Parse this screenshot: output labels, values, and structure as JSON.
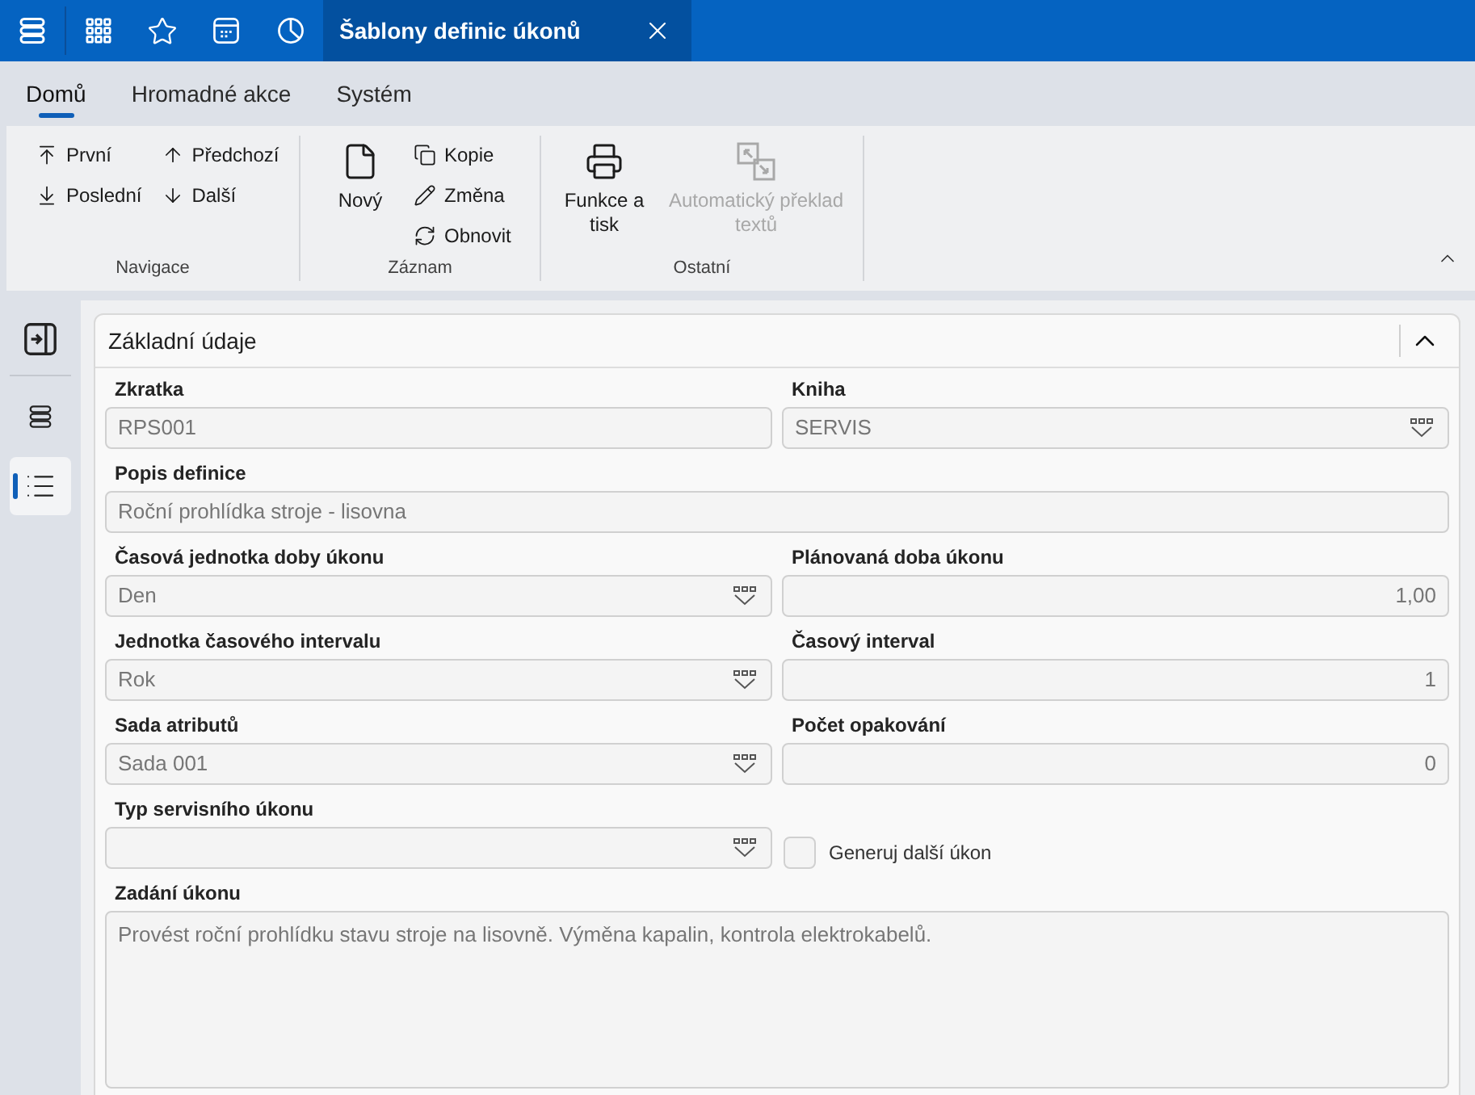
{
  "top_bar": {
    "tab": {
      "title": "Šablony definic úkonů"
    }
  },
  "ribbon_tabs": [
    {
      "label": "Domů",
      "selected": true
    },
    {
      "label": "Hromadné akce",
      "selected": false
    },
    {
      "label": "Systém",
      "selected": false
    }
  ],
  "ribbon": {
    "groups": [
      {
        "label": "Navigace",
        "columns": [
          {
            "items": [
              {
                "label": "První",
                "kind": "small",
                "disabled": false
              },
              {
                "label": "Poslední",
                "kind": "small",
                "disabled": false
              }
            ]
          },
          {
            "items": [
              {
                "label": "Předchozí",
                "kind": "small",
                "disabled": false
              },
              {
                "label": "Další",
                "kind": "small",
                "disabled": false
              }
            ]
          }
        ]
      },
      {
        "label": "Záznam",
        "columns": [
          {
            "items": [
              {
                "label": "Nový",
                "kind": "large",
                "disabled": false
              }
            ]
          },
          {
            "items": [
              {
                "label": "Kopie",
                "kind": "small",
                "disabled": false
              },
              {
                "label": "Změna",
                "kind": "small",
                "disabled": false
              },
              {
                "label": "Obnovit",
                "kind": "small",
                "disabled": false
              }
            ]
          }
        ]
      },
      {
        "label": "Ostatní",
        "columns": [
          {
            "items": [
              {
                "label": "Funkce a tisk",
                "kind": "large",
                "disabled": false
              }
            ]
          },
          {
            "items": [
              {
                "label": "Automatický překlad textů",
                "kind": "large",
                "disabled": true
              }
            ]
          }
        ]
      }
    ]
  },
  "sidebar": {
    "items": [
      {
        "selected": false
      },
      {
        "selected": true
      }
    ]
  },
  "section": {
    "title": "Základní údaje",
    "expanded": true,
    "fields": [
      {
        "label": "Zkratka",
        "kind": "text",
        "value": "RPS001",
        "wide": false
      },
      {
        "label": "Kniha",
        "kind": "select",
        "value": "SERVIS",
        "wide": false
      },
      {
        "label": "Popis definice",
        "kind": "text",
        "value": "Roční prohlídka stroje - lisovna",
        "wide": true
      },
      {
        "label": "Časová jednotka doby úkonu",
        "kind": "select",
        "value": "Den",
        "wide": false
      },
      {
        "label": "Plánovaná doba úkonu",
        "kind": "number",
        "value": "1,00",
        "wide": false
      },
      {
        "label": "Jednotka časového intervalu",
        "kind": "select",
        "value": "Rok",
        "wide": false
      },
      {
        "label": "Časový interval",
        "kind": "number",
        "value": "1",
        "wide": false
      },
      {
        "label": "Sada atributů",
        "kind": "select",
        "value": "Sada 001",
        "wide": false
      },
      {
        "label": "Počet opakování",
        "kind": "number",
        "value": "0",
        "wide": false
      },
      {
        "label": "Typ servisního úkonu",
        "kind": "select",
        "wide": false
      },
      {
        "label": "Generuj další úkon",
        "kind": "checkbox",
        "checked": false
      },
      {
        "label": "Zadání úkonu",
        "kind": "textarea",
        "value": "Provést roční prohlídku stavu stroje na lisovně. Výměna kapalin, kontrola elektrokabelů.",
        "wide": true
      }
    ]
  }
}
